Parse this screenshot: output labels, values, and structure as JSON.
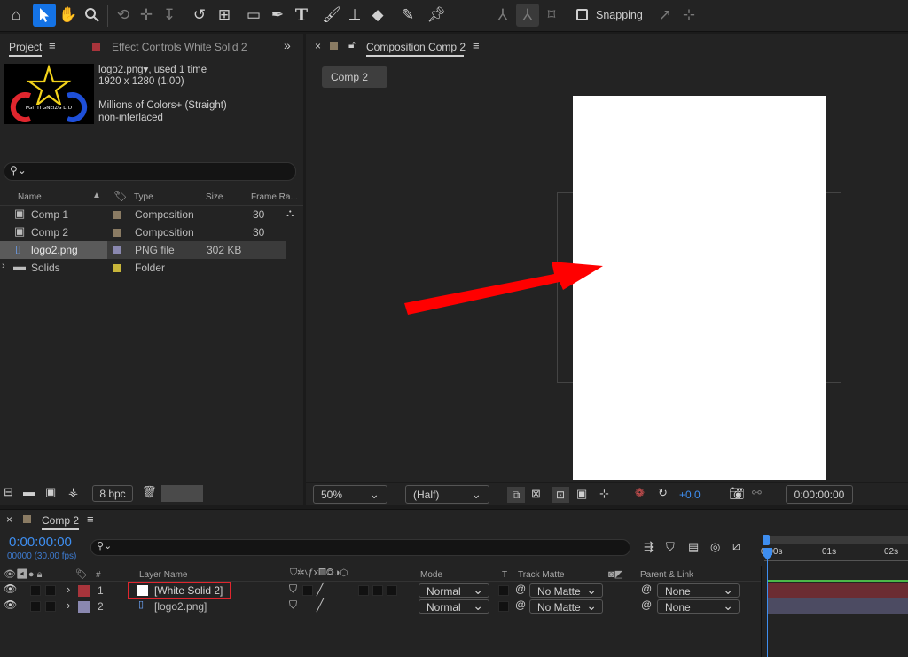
{
  "toolbar": {
    "snapping_label": "Snapping",
    "tools": [
      "home-icon",
      "selection-arrow-icon",
      "hand-icon",
      "zoom-icon",
      "orbit-camera-icon",
      "pan-camera-icon",
      "dolly-camera-icon",
      "rotate-icon",
      "anchor-point-icon",
      "rectangle-icon",
      "pen-icon",
      "text-icon",
      "brush-icon",
      "clone-stamp-icon",
      "eraser-icon",
      "roto-brush-icon",
      "puppet-pin-icon"
    ]
  },
  "project": {
    "tab_label": "Project",
    "effect_tab_label": "Effect Controls White Solid 2",
    "selected_file": "logo2.png",
    "usage": ", used 1 time",
    "dimensions": "1920 x 1280 (1.00)",
    "colors": "Millions of Colors+ (Straight)",
    "interlace": "non-interlaced",
    "search_placeholder": "",
    "columns": {
      "name": "Name",
      "type": "Type",
      "size": "Size",
      "frame_rate": "Frame Ra..."
    },
    "items": [
      {
        "name": "Comp 1",
        "type": "Composition",
        "size": "",
        "frame_rate": "30",
        "color": "#8a7b63"
      },
      {
        "name": "Comp 2",
        "type": "Composition",
        "size": "",
        "frame_rate": "30",
        "color": "#8a7b63"
      },
      {
        "name": "logo2.png",
        "type": "PNG file",
        "size": "302 KB",
        "frame_rate": "",
        "color": "#8a88b0"
      },
      {
        "name": "Solids",
        "type": "Folder",
        "size": "",
        "frame_rate": "",
        "color": "#c7b53a"
      }
    ],
    "bpc": "8 bpc"
  },
  "viewer": {
    "tab_label": "Composition Comp 2",
    "comp_button": "Comp 2",
    "zoom": "50%",
    "resolution": "(Half)",
    "exposure": "+0.0",
    "timecode": "0:00:00:00"
  },
  "timeline": {
    "tab_label": "Comp 2",
    "timecode": "0:00:00:00",
    "frames": "00000 (30.00 fps)",
    "headers": {
      "num": "#",
      "layer_name": "Layer Name",
      "mode": "Mode",
      "t": "T",
      "track_matte": "Track Matte",
      "parent": "Parent & Link"
    },
    "ruler": [
      "0:00s",
      "01s",
      "02s"
    ],
    "layers": [
      {
        "num": "1",
        "name": "[White Solid 2]",
        "mode": "Normal",
        "matte": "No Matte",
        "parent": "None",
        "color": "#a8343b"
      },
      {
        "num": "2",
        "name": "[logo2.png]",
        "mode": "Normal",
        "matte": "No Matte",
        "parent": "None",
        "color": "#8a88b0"
      }
    ]
  },
  "colors": {
    "accent": "#1473e6",
    "arrow": "#ff0000",
    "highlight_box": "#e0262e"
  }
}
